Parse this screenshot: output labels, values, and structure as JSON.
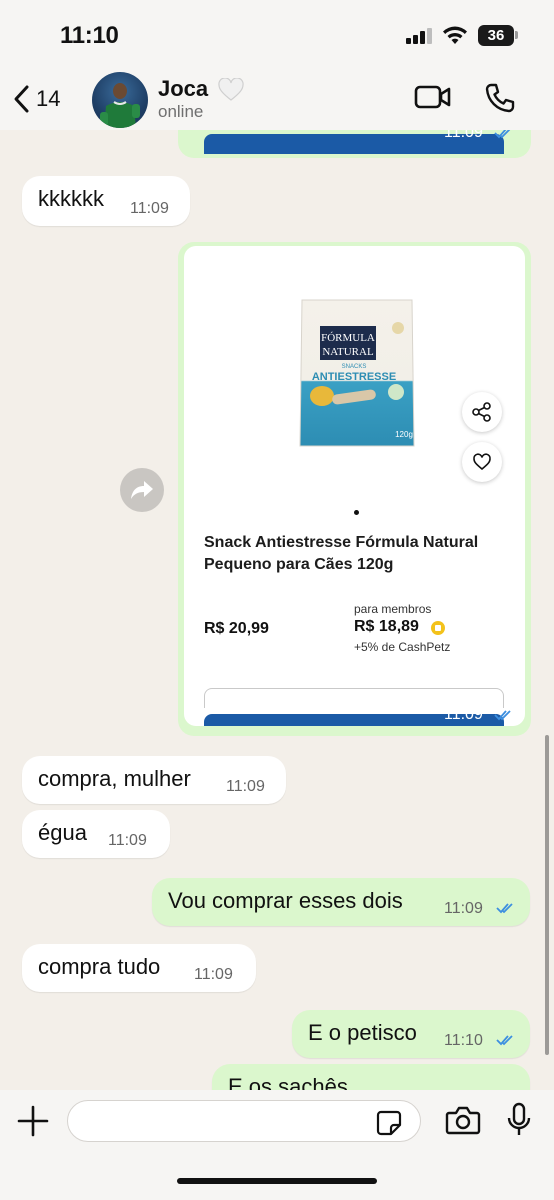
{
  "status_bar": {
    "time": "11:10",
    "battery": "36"
  },
  "header": {
    "back_count": "14",
    "contact_name": "Joca",
    "contact_emoji": "white-heart",
    "contact_status": "online"
  },
  "messages": [
    {
      "direction": "in",
      "text": "kkkkkk",
      "time": "11:09"
    },
    {
      "direction": "out",
      "type": "product",
      "time": "11:09"
    },
    {
      "direction": "in",
      "text": "compra, mulher",
      "time": "11:09"
    },
    {
      "direction": "in",
      "text": "égua",
      "time": "11:09"
    },
    {
      "direction": "out",
      "text": "Vou comprar esses dois",
      "time": "11:09"
    },
    {
      "direction": "in",
      "text": "compra tudo",
      "time": "11:09"
    },
    {
      "direction": "out",
      "text": "E o petisco",
      "time": "11:10"
    },
    {
      "direction": "out",
      "text": "E os sachês",
      "time": ""
    }
  ],
  "top_partial_message": {
    "time": "11:09"
  },
  "product": {
    "title": "Snack Antiestresse Fórmula Natural Pequeno para Cães 120g",
    "price_regular": "R$ 20,99",
    "members_label": "para membros",
    "members_price": "R$ 18,89",
    "cashback": "+5% de CashPetz",
    "package_brand_line1": "FÓRMULA",
    "package_brand_line2": "NATURAL",
    "package_snacks": "SNACKS",
    "package_name": "ANTIESTRESSE",
    "package_weight": "120g"
  },
  "input": {
    "placeholder": ""
  },
  "colors": {
    "chat_bg": "#f3efe9",
    "out_bubble": "#dbf7cd",
    "in_bubble": "#ffffff",
    "read_ticks": "#3d8fe0",
    "brand_blue": "#1b5aa6"
  }
}
